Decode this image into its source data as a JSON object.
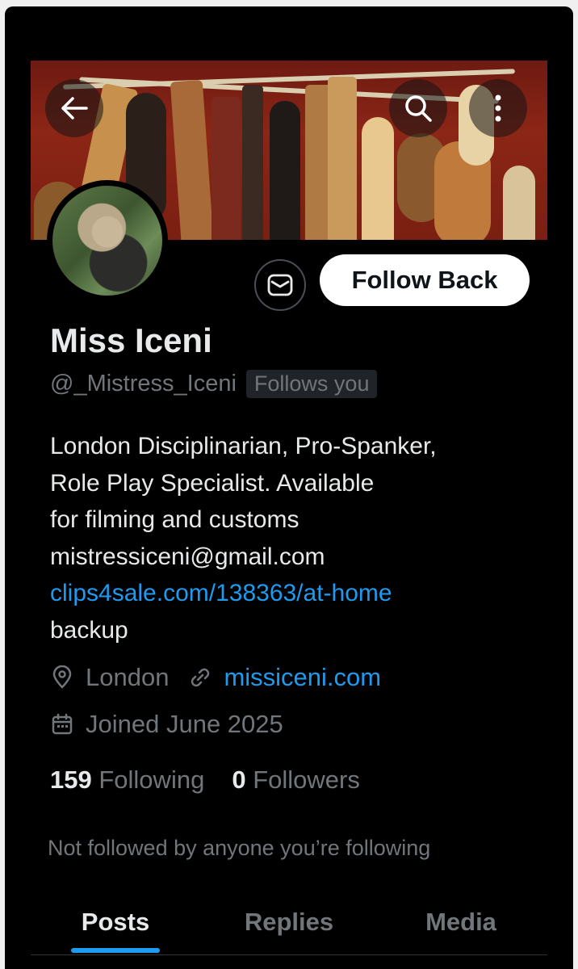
{
  "header": {
    "back_icon": "back-arrow-icon",
    "search_icon": "search-icon",
    "more_icon": "more-vertical-icon"
  },
  "profile": {
    "name": "Miss Iceni",
    "handle": "@_Mistress_Iceni",
    "follows_you": "Follows you",
    "bio_lines": [
      "London Disciplinarian, Pro-Spanker,",
      "Role Play Specialist. Available",
      "for filming and customs",
      "mistressiceni@gmail.com"
    ],
    "bio_link": "clips4sale.com/138363/at-home",
    "bio_tail": "backup",
    "location": "London",
    "website": "missiceni.com",
    "joined": "Joined June 2025",
    "following_count": "159",
    "following_label": "Following",
    "followers_count": "0",
    "followers_label": "Followers",
    "not_followed": "Not followed by anyone you’re following"
  },
  "actions": {
    "message_icon": "mail-icon",
    "follow_back_label": "Follow Back"
  },
  "tabs": [
    {
      "label": "Posts",
      "active": true
    },
    {
      "label": "Replies",
      "active": false
    },
    {
      "label": "Media",
      "active": false
    }
  ],
  "colors": {
    "background": "#000000",
    "text": "#e7e9ea",
    "muted": "#71767b",
    "accent": "#1d9bf0"
  }
}
